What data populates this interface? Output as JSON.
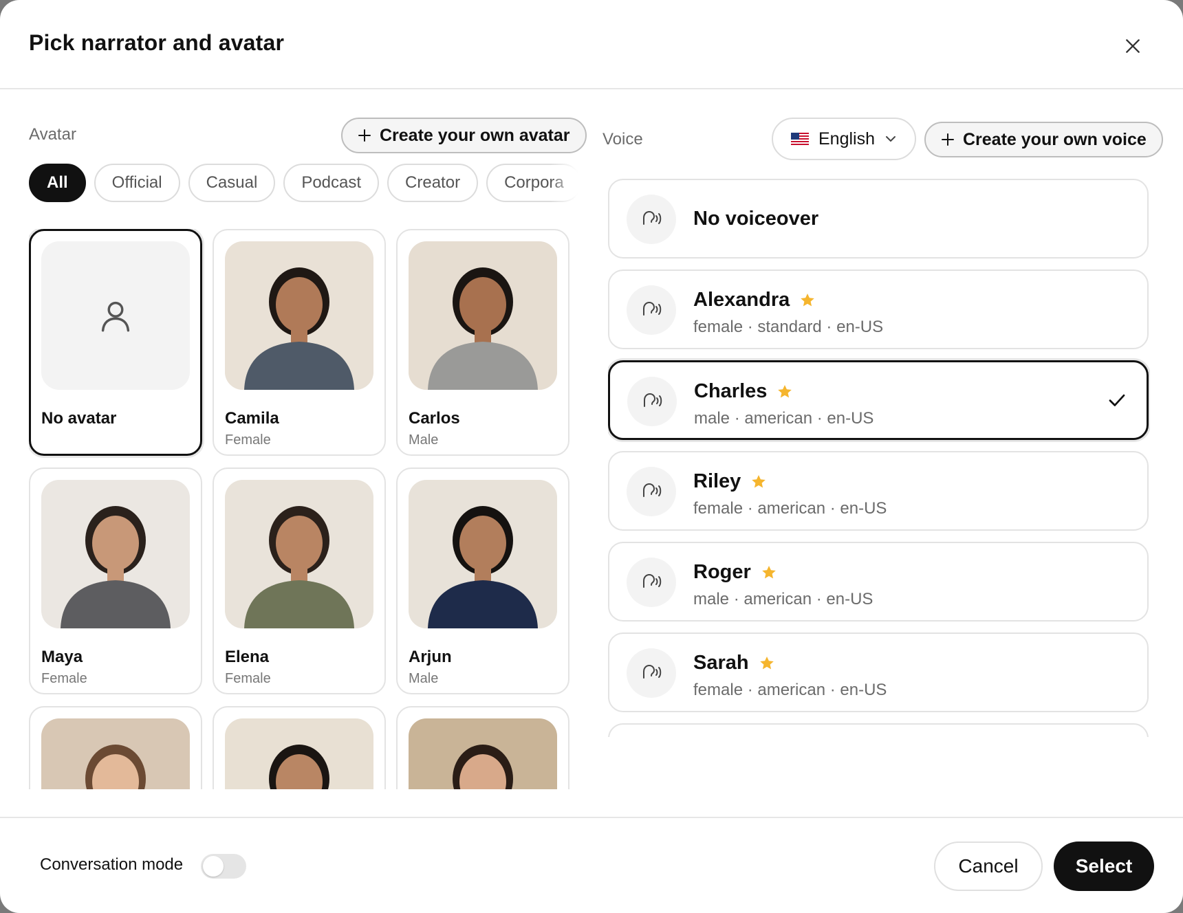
{
  "dialog": {
    "title": "Pick narrator and avatar"
  },
  "avatar": {
    "label": "Avatar",
    "create_label": "Create your own avatar",
    "filters": [
      "All",
      "Official",
      "Casual",
      "Podcast",
      "Creator",
      "Corpora"
    ],
    "active_filter": "All",
    "cards": [
      {
        "name": "No avatar",
        "sub": "",
        "kind": "none",
        "selected": true
      },
      {
        "name": "Camila",
        "sub": "Female",
        "kind": "photo",
        "bg": "#e9e1d6",
        "skin": "#b07a58",
        "hair": "#1f1814",
        "shirt": "#4f5a68"
      },
      {
        "name": "Carlos",
        "sub": "Male",
        "kind": "photo",
        "bg": "#e6ddd1",
        "skin": "#a8714f",
        "hair": "#1a1512",
        "shirt": "#9a9a98"
      },
      {
        "name": "Maya",
        "sub": "Female",
        "kind": "photo",
        "bg": "#ebe7e2",
        "skin": "#c89878",
        "hair": "#2a211c",
        "shirt": "#5d5d60"
      },
      {
        "name": "Elena",
        "sub": "Female",
        "kind": "photo",
        "bg": "#e9e3da",
        "skin": "#b98563",
        "hair": "#2b211b",
        "shirt": "#6f7558"
      },
      {
        "name": "Arjun",
        "sub": "Male",
        "kind": "photo",
        "bg": "#e8e2d9",
        "skin": "#b27e5c",
        "hair": "#151210",
        "shirt": "#1e2b4a"
      },
      {
        "name": "",
        "sub": "",
        "kind": "photo",
        "bg": "#d8c7b4",
        "skin": "#e3b999",
        "hair": "#6b4a33",
        "shirt": "#7a6a5a"
      },
      {
        "name": "",
        "sub": "",
        "kind": "photo",
        "bg": "#e8e0d3",
        "skin": "#b98664",
        "hair": "#1a1512",
        "shirt": "#6a6a5a"
      },
      {
        "name": "",
        "sub": "",
        "kind": "photo",
        "bg": "#c9b497",
        "skin": "#d8a98a",
        "hair": "#2a1d16",
        "shirt": "#5a4a3a"
      }
    ]
  },
  "voice": {
    "label": "Voice",
    "language": "English",
    "create_label": "Create your own voice",
    "items": [
      {
        "name": "No voiceover",
        "meta": "",
        "star": false,
        "selected": false
      },
      {
        "name": "Alexandra",
        "meta": "female · standard · en-US",
        "star": true,
        "selected": false
      },
      {
        "name": "Charles",
        "meta": "male · american · en-US",
        "star": true,
        "selected": true
      },
      {
        "name": "Riley",
        "meta": "female · american · en-US",
        "star": true,
        "selected": false
      },
      {
        "name": "Roger",
        "meta": "male · american · en-US",
        "star": true,
        "selected": false
      },
      {
        "name": "Sarah",
        "meta": "female · american · en-US",
        "star": true,
        "selected": false
      },
      {
        "name": "",
        "meta": "",
        "star": false,
        "selected": false
      }
    ]
  },
  "footer": {
    "conversation_mode_label": "Conversation mode",
    "conversation_mode_on": false,
    "cancel_label": "Cancel",
    "select_label": "Select"
  },
  "colors": {
    "primary": "#111111",
    "star": "#f5b52e",
    "border": "#e3e3e3",
    "muted": "#6b6b6b"
  },
  "icons": {
    "close": "close-icon",
    "plus": "plus-icon",
    "flag": "us-flag-icon",
    "chevron": "chevron-down-icon",
    "voice": "voice-wave-icon",
    "star": "star-icon",
    "check": "check-icon",
    "person": "person-outline-icon"
  }
}
